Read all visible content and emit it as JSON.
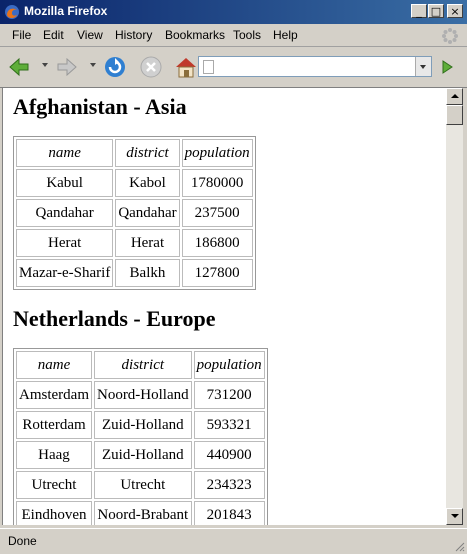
{
  "window": {
    "title": "Mozilla Firefox"
  },
  "menu": [
    "File",
    "Edit",
    "View",
    "History",
    "Bookmarks",
    "Tools",
    "Help"
  ],
  "url": {
    "value": ""
  },
  "status": "Done",
  "columns": [
    "name",
    "district",
    "population"
  ],
  "sections": [
    {
      "heading": "Afghanistan - Asia",
      "rows": [
        [
          "Kabul",
          "Kabol",
          "1780000"
        ],
        [
          "Qandahar",
          "Qandahar",
          "237500"
        ],
        [
          "Herat",
          "Herat",
          "186800"
        ],
        [
          "Mazar-e-Sharif",
          "Balkh",
          "127800"
        ]
      ]
    },
    {
      "heading": "Netherlands - Europe",
      "rows": [
        [
          "Amsterdam",
          "Noord-Holland",
          "731200"
        ],
        [
          "Rotterdam",
          "Zuid-Holland",
          "593321"
        ],
        [
          "Haag",
          "Zuid-Holland",
          "440900"
        ],
        [
          "Utrecht",
          "Utrecht",
          "234323"
        ],
        [
          "Eindhoven",
          "Noord-Brabant",
          "201843"
        ]
      ]
    }
  ],
  "colors": {
    "titlebar_start": "#0a246a",
    "titlebar_end": "#3a6ea5",
    "chrome": "#d4d0c8"
  }
}
